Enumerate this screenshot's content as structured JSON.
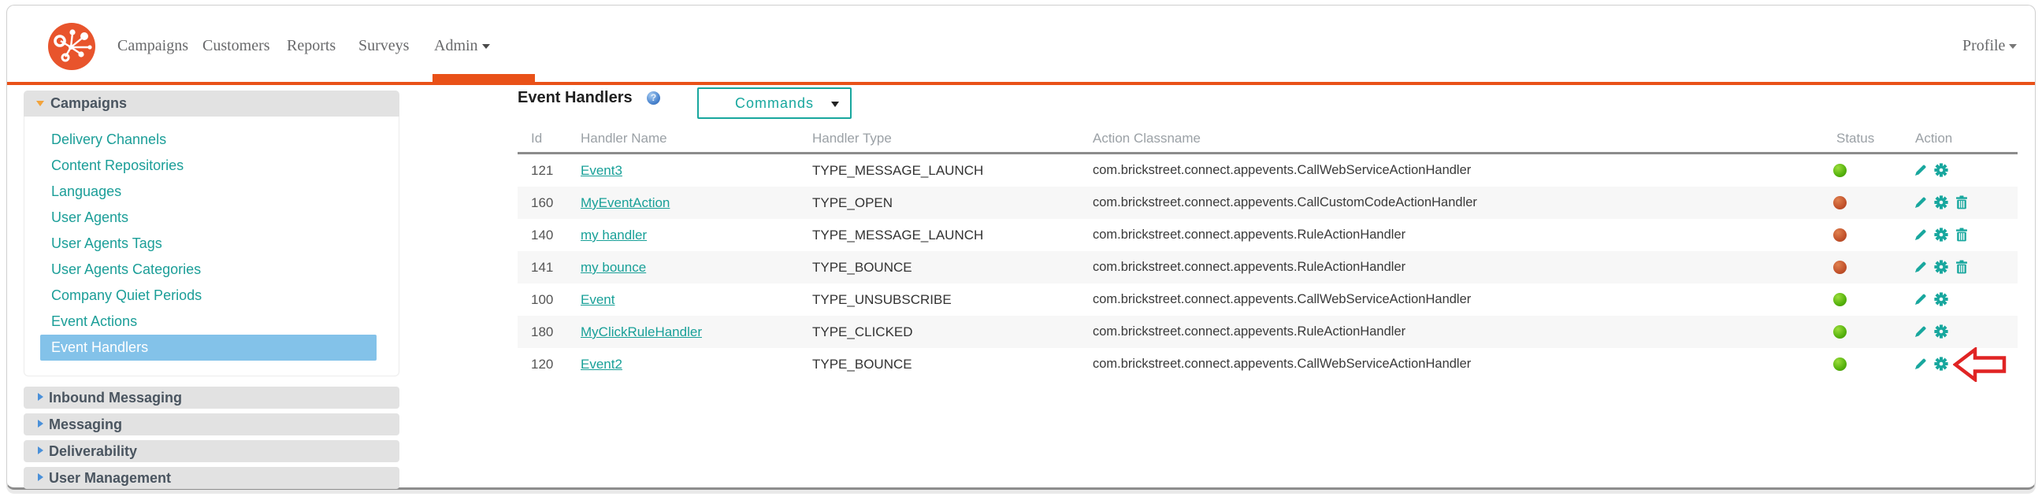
{
  "nav": {
    "items": [
      {
        "label": "Campaigns"
      },
      {
        "label": "Customers"
      },
      {
        "label": "Reports"
      },
      {
        "label": "Surveys"
      },
      {
        "label": "Admin",
        "active": true,
        "has_dropdown": true
      }
    ],
    "profile": {
      "label": "Profile",
      "has_dropdown": true
    }
  },
  "sidebar": {
    "sections": [
      {
        "label": "Campaigns",
        "expanded": true,
        "items": [
          {
            "label": "Delivery Channels"
          },
          {
            "label": "Content Repositories"
          },
          {
            "label": "Languages"
          },
          {
            "label": "User Agents"
          },
          {
            "label": "User Agents Tags"
          },
          {
            "label": "User Agents Categories"
          },
          {
            "label": "Company Quiet Periods"
          },
          {
            "label": "Event Actions"
          },
          {
            "label": "Event Handlers",
            "selected": true
          }
        ]
      },
      {
        "label": "Inbound Messaging",
        "expanded": false
      },
      {
        "label": "Messaging",
        "expanded": false
      },
      {
        "label": "Deliverability",
        "expanded": false
      },
      {
        "label": "User Management",
        "expanded": false
      }
    ]
  },
  "main": {
    "title": "Event Handlers",
    "commands_dropdown": {
      "label": "Commands"
    },
    "table": {
      "columns": [
        "Id",
        "Handler Name",
        "Handler Type",
        "Action Classname",
        "Status",
        "Action"
      ],
      "rows": [
        {
          "id": "121",
          "name": "Event3",
          "type": "TYPE_MESSAGE_LAUNCH",
          "classname": "com.brickstreet.connect.appevents.CallWebServiceActionHandler",
          "status": "active",
          "actions": [
            "edit",
            "settings"
          ]
        },
        {
          "id": "160",
          "name": "MyEventAction",
          "type": "TYPE_OPEN",
          "classname": "com.brickstreet.connect.appevents.CallCustomCodeActionHandler",
          "status": "inactive",
          "actions": [
            "edit",
            "settings",
            "delete"
          ]
        },
        {
          "id": "140",
          "name": "my handler",
          "type": "TYPE_MESSAGE_LAUNCH",
          "classname": "com.brickstreet.connect.appevents.RuleActionHandler",
          "status": "inactive",
          "actions": [
            "edit",
            "settings",
            "delete"
          ]
        },
        {
          "id": "141",
          "name": "my bounce",
          "type": "TYPE_BOUNCE",
          "classname": "com.brickstreet.connect.appevents.RuleActionHandler",
          "status": "inactive",
          "actions": [
            "edit",
            "settings",
            "delete"
          ]
        },
        {
          "id": "100",
          "name": "Event",
          "type": "TYPE_UNSUBSCRIBE",
          "classname": "com.brickstreet.connect.appevents.CallWebServiceActionHandler",
          "status": "active",
          "actions": [
            "edit",
            "settings"
          ]
        },
        {
          "id": "180",
          "name": "MyClickRuleHandler",
          "type": "TYPE_CLICKED",
          "classname": "com.brickstreet.connect.appevents.RuleActionHandler",
          "status": "active",
          "actions": [
            "edit",
            "settings"
          ]
        },
        {
          "id": "120",
          "name": "Event2",
          "type": "TYPE_BOUNCE",
          "classname": "com.brickstreet.connect.appevents.CallWebServiceActionHandler",
          "status": "active",
          "actions": [
            "edit",
            "settings"
          ],
          "annotation": "red-arrow-pointing-left-at-settings"
        }
      ]
    }
  },
  "colors": {
    "brand_orange": "#e95118",
    "teal": "#18a79e",
    "selected_blue": "#83c2e9",
    "status_active_green": "#55b20c",
    "status_inactive_red": "#c2522b",
    "annotation_red": "#e02424"
  },
  "help_icon_glyph": "?"
}
